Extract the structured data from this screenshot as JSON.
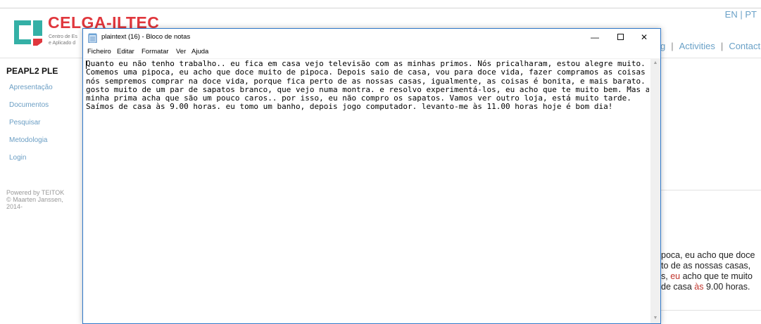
{
  "site": {
    "lang": {
      "en": "EN",
      "sep": "|",
      "pt": "PT"
    },
    "logo": {
      "name": "CELGA-ILTEC",
      "sub1": "Centro de Es",
      "sub2": "e Aplicado d"
    },
    "nav": {
      "partial": "g",
      "activities": "Activities",
      "contact": "Contact",
      "sep": "|"
    },
    "title": "PEAPL2 PLE",
    "menu": [
      "Apresentação",
      "Documentos",
      "Pesquisar",
      "Metodologia",
      "Login"
    ],
    "powered": [
      "Powered by TEITOK",
      "© Maarten Janssen,",
      "2014-"
    ],
    "content_lines": [
      {
        "a": "poca, eu acho que doce",
        "red": "",
        "b": ""
      },
      {
        "a": "to de as nossas casas,",
        "red": "",
        "b": ""
      },
      {
        "a": "s, ",
        "red": "eu",
        "b": " acho que te muito"
      },
      {
        "a": " de casa ",
        "red": "às",
        "b": " 9.00 horas."
      }
    ]
  },
  "notepad": {
    "title": "plaintext (16) - Bloco de notas",
    "menus": [
      "Ficheiro",
      "Editar",
      "Formatar",
      "Ver",
      "Ajuda"
    ],
    "text": "Quanto eu não tenho trabalho.. eu fica em casa vejo televisão com as minhas primos. Nós pricalharam, estou alegre muito.\nComemos uma pipoca, eu acho que doce muito de pipoca. Depois saio de casa, vou para doce vida, fazer compramos as coisas\nnós sempremos comprar na doce vida, porque fica perto de as nossas casas, igualmente, as coisas é bonita, e mais barato. Eu\ngosto muito de um par de sapatos branco, que vejo numa montra. e resolvo experimentá-los, eu acho que te muito bem. Mas a\nminha prima acha que são um pouco caros.. por isso, eu não compro os sapatos. Vamos ver outro loja, está muito tarde.\nSaímos de casa às 9.00 horas. eu tomo um banho, depois jogo computador. levanto-me às 11.00 horas hoje é bom dia!",
    "controls": {
      "minimize": "—",
      "close": "✕"
    }
  },
  "colors": {
    "accent": "#e0373d",
    "link": "#6aa1c7",
    "window_border": "#2f78c9"
  },
  "icons": {
    "notepad": "notepad-icon",
    "logo": "logo-icon"
  }
}
